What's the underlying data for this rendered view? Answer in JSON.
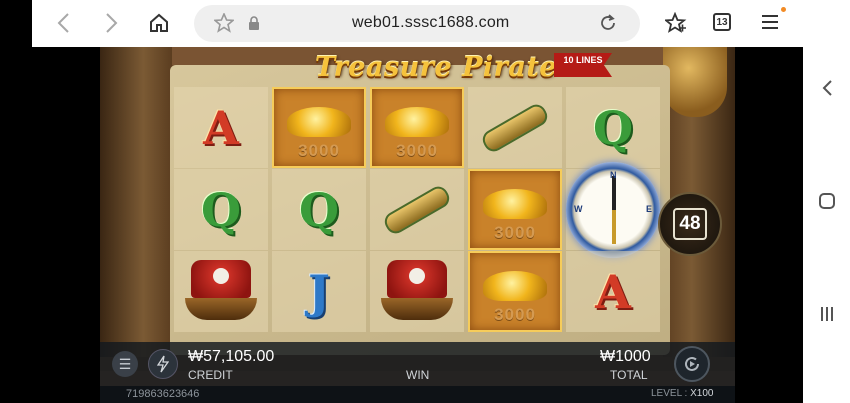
{
  "browser": {
    "url": "web01.sssc1688.com",
    "tab_count": "13"
  },
  "game": {
    "title": "Treasure Pirate",
    "lines_tag": "10 LINES",
    "counter": "48",
    "reels": [
      [
        {
          "symbol": "A",
          "win": false
        },
        {
          "symbol": "Q",
          "win": false
        },
        {
          "symbol": "ship",
          "win": false
        }
      ],
      [
        {
          "symbol": "gold",
          "value": "3000",
          "win": true
        },
        {
          "symbol": "Q",
          "win": false
        },
        {
          "symbol": "J",
          "win": false
        }
      ],
      [
        {
          "symbol": "gold",
          "value": "3000",
          "win": true
        },
        {
          "symbol": "spyglass",
          "win": false
        },
        {
          "symbol": "ship",
          "win": false
        }
      ],
      [
        {
          "symbol": "spyglass",
          "win": false
        },
        {
          "symbol": "gold",
          "value": "3000",
          "win": true
        },
        {
          "symbol": "gold",
          "value": "3000",
          "win": true
        }
      ],
      [
        {
          "symbol": "Q",
          "win": false
        },
        {
          "symbol": "compass",
          "win": false
        },
        {
          "symbol": "A",
          "win": false
        }
      ]
    ],
    "compass_dirs": {
      "n": "N",
      "w": "W",
      "e": "E"
    }
  },
  "panel": {
    "credit_value": "₩57,105.00",
    "credit_label": "CREDIT",
    "win_label": "WIN",
    "total_value": "₩1000",
    "total_label": "TOTAL"
  },
  "footer": {
    "round_id": "719863623646",
    "level_label": "LEVEL : ",
    "level_value": "X100"
  }
}
